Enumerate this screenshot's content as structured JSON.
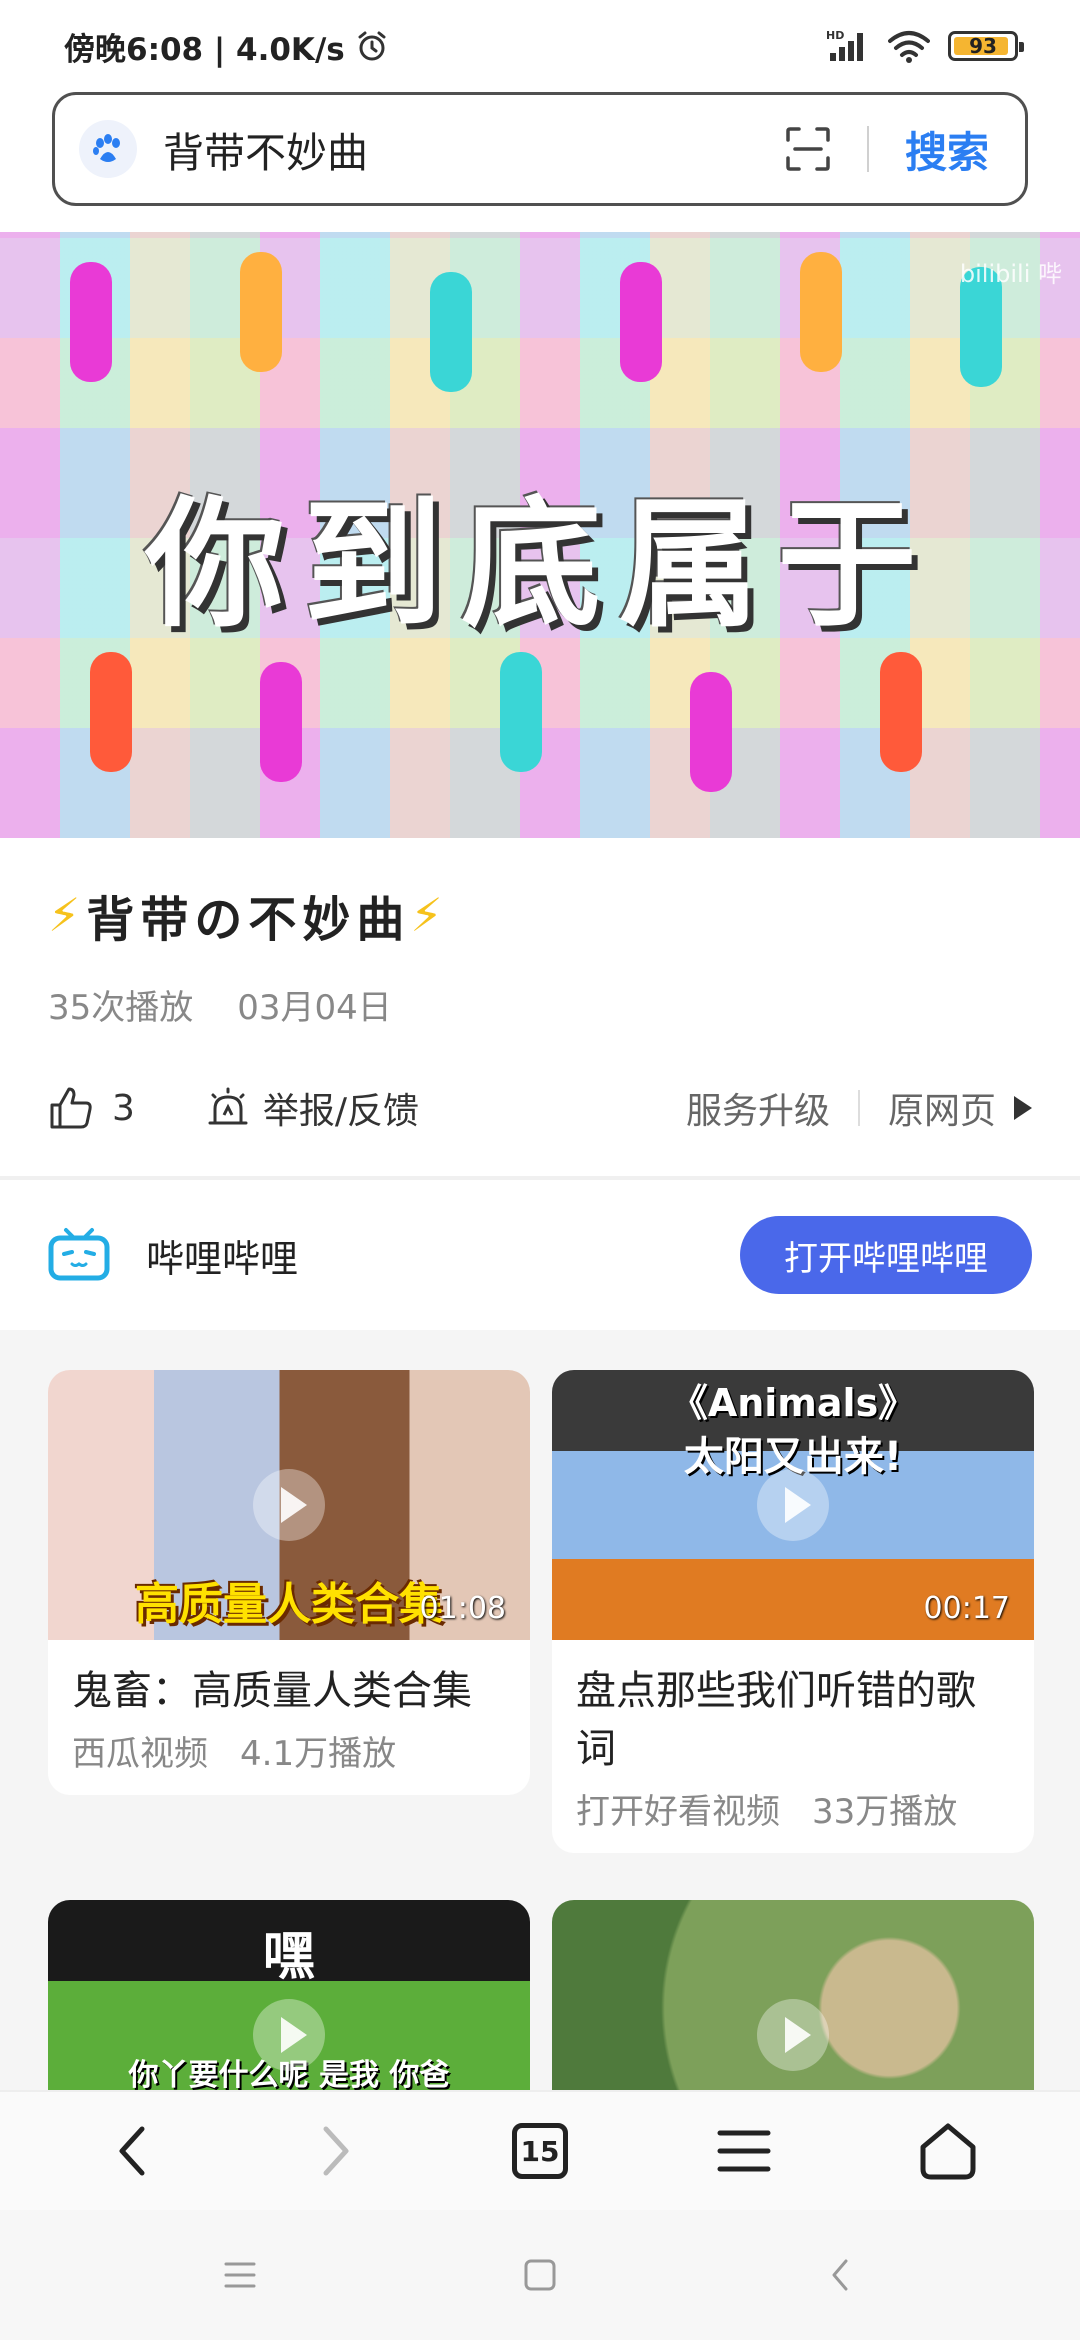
{
  "status_bar": {
    "time_speed": "傍晚6:08 | 4.0K/s",
    "network_label": "HD",
    "battery_level": "93",
    "battery_fraction": 0.93
  },
  "search": {
    "query": "背带不妙曲",
    "button_label": "搜索"
  },
  "video": {
    "caption": "你到底属于",
    "watermark": "bilibili 哔"
  },
  "title": {
    "text": "背带の不妙曲",
    "emoji": "⚡"
  },
  "meta": {
    "plays": "35次播放",
    "date": "03月04日"
  },
  "actions": {
    "like_count": "3",
    "report_label": "举报/反馈",
    "upgrade_label": "服务升级",
    "original_label": "原网页"
  },
  "source": {
    "name": "哔哩哔哩",
    "open_button": "打开哔哩哔哩"
  },
  "feed": {
    "cards": [
      {
        "title": "鬼畜：高质量人类合集",
        "source": "西瓜视频",
        "plays": "4.1万播放",
        "duration": "01:08",
        "overlay": "高质量人类合集"
      },
      {
        "title": "盘点那些我们听错的歌词",
        "source": "打开好看视频",
        "plays": "33万播放",
        "duration": "00:17",
        "overlay_top": "《Animals》",
        "overlay": "太阳又出来!"
      },
      {
        "overlay_top": "嘿",
        "overlay": "你丫要什么呢 是我 你爸"
      },
      {
        "overlay": ""
      }
    ]
  },
  "browser_bar": {
    "tab_count": "15"
  },
  "colors": {
    "accent": "#2b7ef2",
    "open_button": "#4a68ea",
    "bilibili_icon": "#23ade5",
    "battery": "#f5b531"
  }
}
